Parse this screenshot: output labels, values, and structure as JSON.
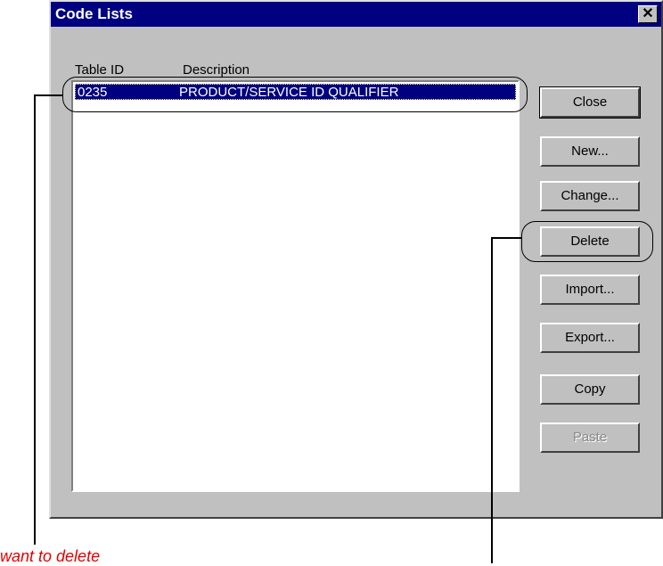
{
  "dialog": {
    "title": "Code Lists",
    "close_glyph": "✕"
  },
  "list": {
    "headers": {
      "table_id": "Table ID",
      "description": "Description"
    },
    "rows": [
      {
        "table_id": "0235",
        "description": "PRODUCT/SERVICE ID QUALIFIER"
      }
    ]
  },
  "buttons": {
    "close": "Close",
    "new": "New...",
    "change": "Change...",
    "delete": "Delete",
    "import": "Import...",
    "export": "Export...",
    "copy": "Copy",
    "paste": "Paste"
  },
  "annotations": {
    "callout_left": "want to delete"
  }
}
